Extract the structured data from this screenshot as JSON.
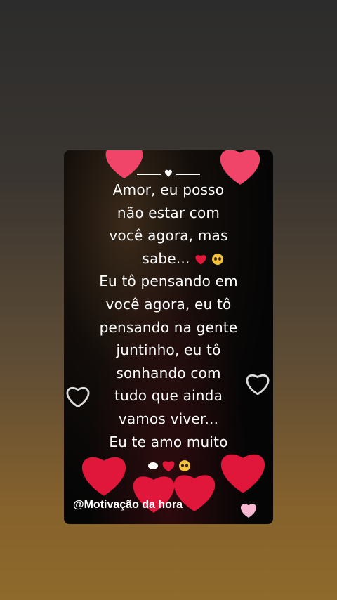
{
  "message_lines": [
    "Amor,  eu posso",
    "não  estar com",
    "você agora,  mas",
    "sabe...",
    "Eu tô pensando  em",
    "você agora, eu tô",
    "pensando na gente",
    "juntinho, eu tô",
    "sonhando com",
    "tudo que ainda",
    "vamos viver...",
    "Eu te amo muito"
  ],
  "watermark": "@Motivação da hora",
  "colors": {
    "heart_red": "#e0163a",
    "heart_pink": "#f04468",
    "text": "#ffffff"
  },
  "icons": [
    "heart-emoji",
    "pleading-face-emoji",
    "thought-bubble-emoji"
  ]
}
